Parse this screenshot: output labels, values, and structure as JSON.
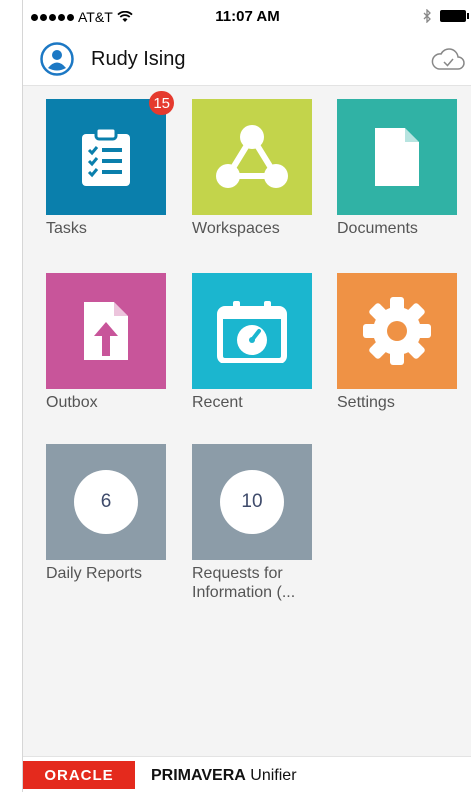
{
  "status_bar": {
    "carrier": "AT&T",
    "time": "11:07 AM",
    "icons": [
      "signal-dots-icon",
      "wifi-icon",
      "bluetooth-icon",
      "battery-icon"
    ]
  },
  "header": {
    "user_name": "Rudy Ising",
    "avatar_icon": "user-avatar-icon",
    "sync_icon": "cloud-check-icon"
  },
  "tiles": [
    {
      "label": "Tasks",
      "color": "#0a7fac",
      "icon": "clipboard-checklist-icon",
      "badge": "15"
    },
    {
      "label": "Workspaces",
      "color": "#c3d44b",
      "icon": "network-triangle-icon"
    },
    {
      "label": "Documents",
      "color": "#30b2a5",
      "icon": "document-icon"
    },
    {
      "label": "Outbox",
      "color": "#c8559a",
      "icon": "upload-document-icon"
    },
    {
      "label": "Recent",
      "color": "#1bb6cf",
      "icon": "calendar-gauge-icon"
    },
    {
      "label": "Settings",
      "color": "#ef9245",
      "icon": "gear-icon"
    },
    {
      "label": "Daily Reports",
      "color": "#8c9ca8",
      "count": "6"
    },
    {
      "label": "Requests for Information (...",
      "label_line1": "Requests for",
      "label_line2": "Information (...",
      "color": "#8c9ca8",
      "count": "10"
    }
  ],
  "footer": {
    "brand": "ORACLE",
    "product_bold": "PRIMAVERA",
    "product_rest": "Unifier"
  }
}
